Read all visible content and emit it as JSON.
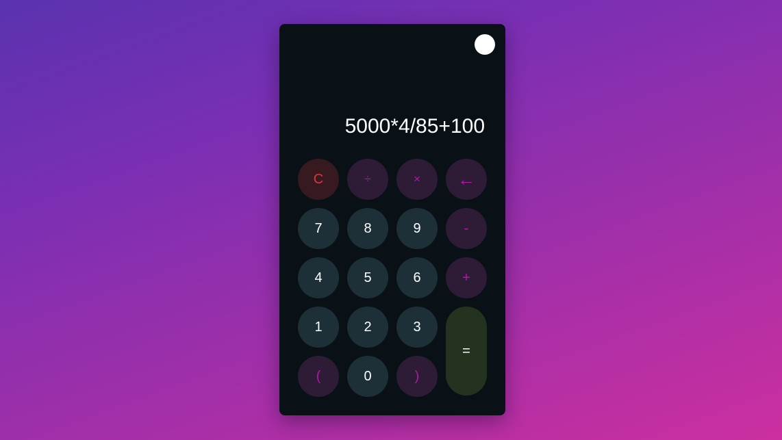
{
  "display": {
    "expression": "5000*4/85+100"
  },
  "keys": {
    "clear": "C",
    "divide": "÷",
    "multiply": "×",
    "backspace": "←",
    "seven": "7",
    "eight": "8",
    "nine": "9",
    "minus": "-",
    "four": "4",
    "five": "5",
    "six": "6",
    "plus": "+",
    "one": "1",
    "two": "2",
    "three": "3",
    "equals": "=",
    "open_paren": "(",
    "zero": "0",
    "close_paren": ")"
  },
  "colors": {
    "background_start": "#5a32b0",
    "background_end": "#cc2fa0",
    "calculator_bg": "#091116",
    "number_key_bg": "#1d3038",
    "operator_key_bg": "#2e1c36",
    "operator_text": "#b018a8",
    "clear_key_bg": "#361a20",
    "clear_text": "#e2313f",
    "equals_key_bg": "#23331f",
    "toggle": "#ffffff"
  }
}
